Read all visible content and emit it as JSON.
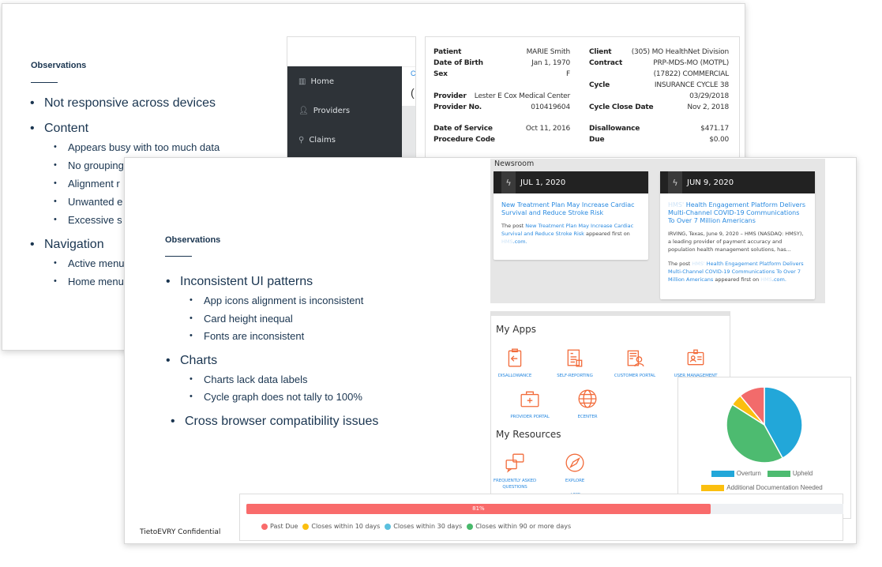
{
  "slide_back": {
    "heading": "Observations",
    "bullets": [
      {
        "text": "Not responsive across devices",
        "sub": []
      },
      {
        "text": "Content",
        "sub": [
          "Appears busy with too much data",
          "No grouping",
          "Alignment r",
          "Unwanted e",
          "Excessive s"
        ]
      },
      {
        "text": "Navigation",
        "sub": [
          "Active menu",
          "Home menu"
        ]
      }
    ],
    "sidebar": {
      "items": [
        {
          "label": "Home",
          "icon": "building-icon"
        },
        {
          "label": "Providers",
          "icon": "user-icon"
        },
        {
          "label": "Claims",
          "icon": "search-icon"
        }
      ],
      "peek_link": "C",
      "peek_text": "("
    },
    "patient_card": {
      "left": [
        {
          "label": "Patient",
          "value": "MARIE Smith"
        },
        {
          "label": "Date of Birth",
          "value": "Jan 1, 1970"
        },
        {
          "label": "Sex",
          "value": "F"
        },
        {
          "label": "Provider",
          "value": "Lester E Cox Medical Center"
        },
        {
          "label": "Provider No.",
          "value": "010419604"
        },
        {
          "label": "Date of Service",
          "value": "Oct 11, 2016"
        },
        {
          "label": "Procedure Code",
          "value": ""
        }
      ],
      "right": [
        {
          "label": "Client",
          "value": "(305) MO HealthNet Division"
        },
        {
          "label": "Contract",
          "value": "PRP-MDS-MO (MOTPL)"
        },
        {
          "label": "",
          "value": "(17822) COMMERCIAL"
        },
        {
          "label": "Cycle",
          "value": "INSURANCE CYCLE 38"
        },
        {
          "label": "",
          "value": "03/29/2018"
        },
        {
          "label": "Cycle Close Date",
          "value": "Nov 2, 2018"
        },
        {
          "label": "Disallowance",
          "value": "$471.17"
        },
        {
          "label": "Due",
          "value": "$0.00"
        }
      ]
    }
  },
  "slide_front": {
    "heading": "Observations",
    "bullets": [
      {
        "text": "Inconsistent UI patterns",
        "sub": [
          "App icons alignment is inconsistent",
          "Card height inequal",
          "Fonts are inconsistent"
        ]
      },
      {
        "text": "Charts",
        "sub": [
          "Charts lack data labels",
          "Cycle graph does not tally to 100%"
        ]
      },
      {
        "text": "Cross browser compatibility issues",
        "sub": []
      }
    ],
    "footer": "TietoEVRY Confidential",
    "newsroom": {
      "title": "Newsroom",
      "cards": [
        {
          "date": "JUL 1, 2020",
          "title": "New Treatment Plan May Increase Cardiac Survival and Reduce Stroke Risk",
          "excerpt": "",
          "post_prefix": "The post ",
          "post_link": "New Treatment Plan May Increase Cardiac Survival and Reduce Stroke Risk",
          "post_suffix": " appeared first on ",
          "site_faint": "HMS",
          "site_suffix": ".com."
        },
        {
          "date": "JUN 9, 2020",
          "title_faint": "HMS'",
          "title": " Health Engagement Platform Delivers Multi-Channel COVID-19 Communications To Over 7 Million Americans",
          "excerpt": "IRVING, Texas, June 9, 2020 – HMS (NASDAQ: HMSY), a leading provider of payment accuracy and population health management solutions, has...",
          "post_prefix": "The post ",
          "post_faint": "HMS'",
          "post_link": " Health Engagement Platform Delivers Multi-Channel COVID-19 Communications To Over 7 Million Americans",
          "post_suffix": " appeared first on ",
          "site_faint": "HMS",
          "site_suffix": ".com."
        }
      ]
    },
    "my_apps": {
      "title": "My Apps",
      "apps": [
        {
          "label": "DISALLOWANCE",
          "icon": "clipboard-arrow-icon"
        },
        {
          "label": "SELF-REPORTING",
          "icon": "report-icon"
        },
        {
          "label": "CUSTOMER PORTAL",
          "icon": "customer-building-icon"
        },
        {
          "label": "USER MANAGEMENT",
          "icon": "id-badge-icon"
        },
        {
          "label": "PROVIDER PORTAL",
          "icon": "medical-kit-icon"
        },
        {
          "label": "ECENTER",
          "icon": "globe-icon"
        }
      ],
      "resources_title": "My Resources",
      "resources": [
        {
          "label": "FREQUENTLY ASKED QUESTIONS",
          "icon": "qa-bubbles-icon"
        },
        {
          "label": "EXPLORE",
          "label_faint": "HMS",
          "icon": "compass-icon"
        }
      ],
      "accent": "#f26b3a"
    },
    "progress": {
      "value_percent": 81,
      "label": "81%",
      "color": "#f96b6b",
      "legend": [
        {
          "label": "Past Due",
          "color": "#f96b6b"
        },
        {
          "label": "Closes within 10 days",
          "color": "#fbbf0f"
        },
        {
          "label": "Closes within 30 days",
          "color": "#5bc0de"
        },
        {
          "label": "Closes within 90 or more days",
          "color": "#48b96b"
        }
      ]
    }
  },
  "chart_data": {
    "type": "pie",
    "slices": [
      {
        "name": "Overturn",
        "value": 42,
        "color": "#22a7d9"
      },
      {
        "name": "Upheld",
        "value": 42,
        "color": "#4dbb70"
      },
      {
        "name": "Additional Documentation Needed",
        "value": 5,
        "color": "#fbbf0f"
      },
      {
        "value": 11,
        "color": "#f26b6b"
      }
    ],
    "legend": [
      "Overturn",
      "Upheld",
      "Additional Documentation Needed"
    ],
    "legend_placement": "bottom",
    "data_labels": false
  }
}
